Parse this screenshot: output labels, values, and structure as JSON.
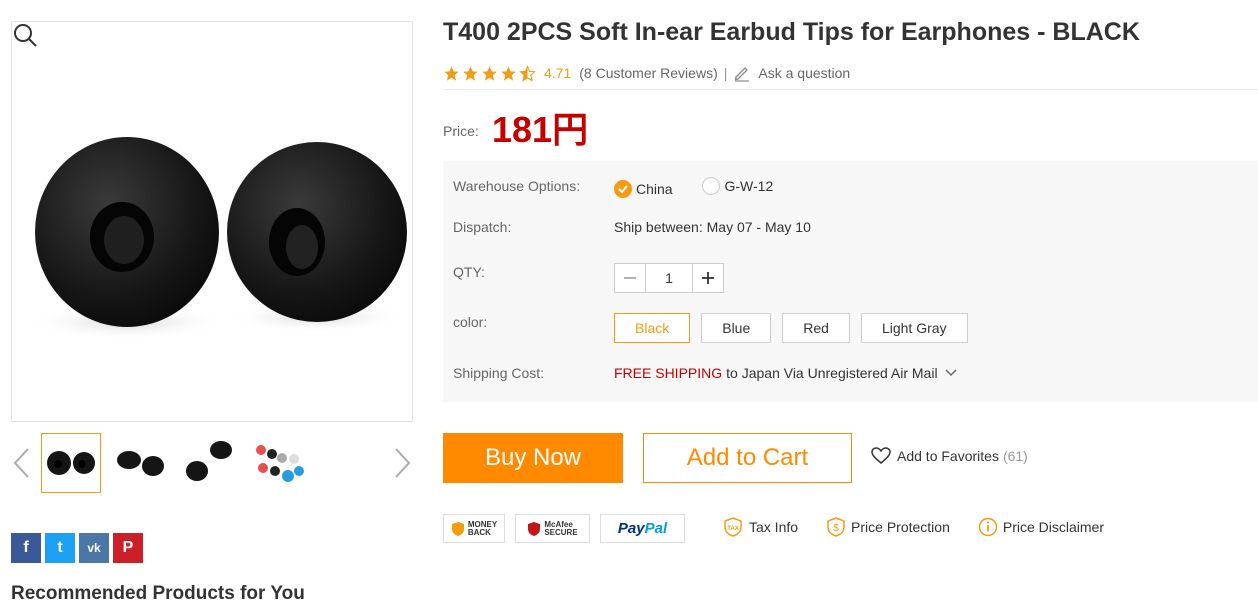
{
  "product": {
    "title": "T400 2PCS Soft In-ear Earbud Tips for Earphones - BLACK",
    "rating": "4.71",
    "stars": 4.5,
    "reviews": "(8 Customer Reviews)",
    "separator": "|",
    "ask_question": "Ask a question",
    "price_label": "Price:",
    "price": "181円"
  },
  "options": {
    "warehouse_label": "Warehouse Options:",
    "warehouses": [
      {
        "label": "China",
        "checked": true
      },
      {
        "label": "G-W-12",
        "checked": false
      }
    ],
    "dispatch_label": "Dispatch:",
    "dispatch_value": "Ship between: May 07 - May 10",
    "qty_label": "QTY:",
    "qty_value": "1",
    "color_label": "color:",
    "colors": [
      "Black",
      "Blue",
      "Red",
      "Light Gray"
    ],
    "selected_color": "Black",
    "shipping_label": "Shipping Cost:",
    "shipping_free": "FREE SHIPPING",
    "shipping_rest": "to Japan Via Unregistered Air Mail"
  },
  "actions": {
    "buy_now": "Buy Now",
    "add_to_cart": "Add to Cart",
    "favorites": "Add to Favorites",
    "favorites_count": "(61)"
  },
  "badges": {
    "money_back_1": "MONEY",
    "money_back_2": "BACK",
    "mcafee_1": "McAfee",
    "mcafee_2": "SECURE",
    "paypal_1": "Pay",
    "paypal_2": "Pal"
  },
  "info": {
    "tax": "Tax Info",
    "price_protection": "Price Protection",
    "price_disclaimer": "Price Disclaimer"
  },
  "share": {
    "facebook": "f",
    "twitter": "t",
    "vk": "vk",
    "pinterest": "P"
  },
  "recommended_title": "Recommended Products for You",
  "colors": {
    "accent": "#ff8a00",
    "star": "#f39c12",
    "price": "#c40000"
  }
}
